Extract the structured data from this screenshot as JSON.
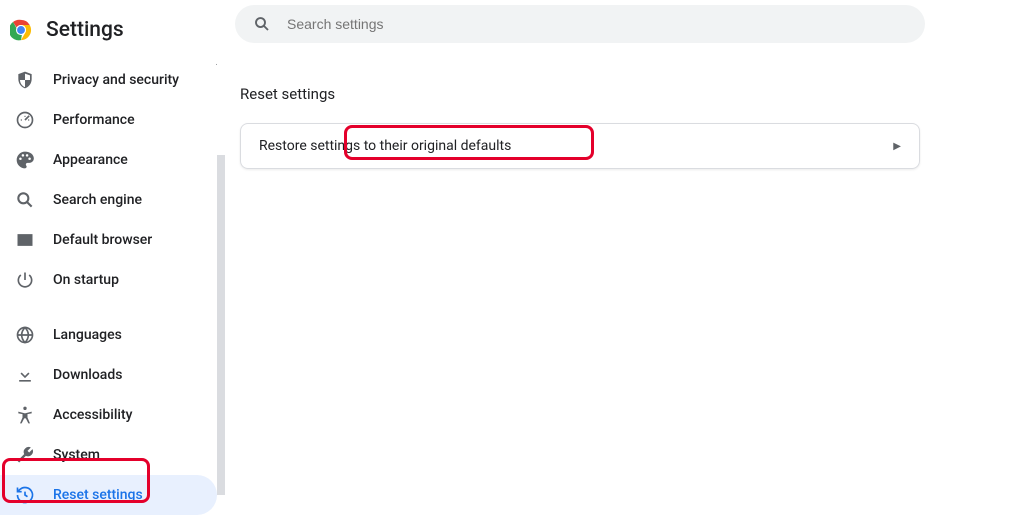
{
  "header": {
    "title": "Settings"
  },
  "search": {
    "placeholder": "Search settings"
  },
  "sidebar": {
    "items": [
      {
        "label": "Privacy and security",
        "icon": "shield"
      },
      {
        "label": "Performance",
        "icon": "speedometer"
      },
      {
        "label": "Appearance",
        "icon": "palette"
      },
      {
        "label": "Search engine",
        "icon": "search"
      },
      {
        "label": "Default browser",
        "icon": "browser"
      },
      {
        "label": "On startup",
        "icon": "power"
      }
    ],
    "items2": [
      {
        "label": "Languages",
        "icon": "globe"
      },
      {
        "label": "Downloads",
        "icon": "download"
      },
      {
        "label": "Accessibility",
        "icon": "accessibility"
      },
      {
        "label": "System",
        "icon": "wrench"
      },
      {
        "label": "Reset settings",
        "icon": "history"
      }
    ]
  },
  "main": {
    "section_title": "Reset settings",
    "card_label": "Restore settings to their original defaults"
  }
}
